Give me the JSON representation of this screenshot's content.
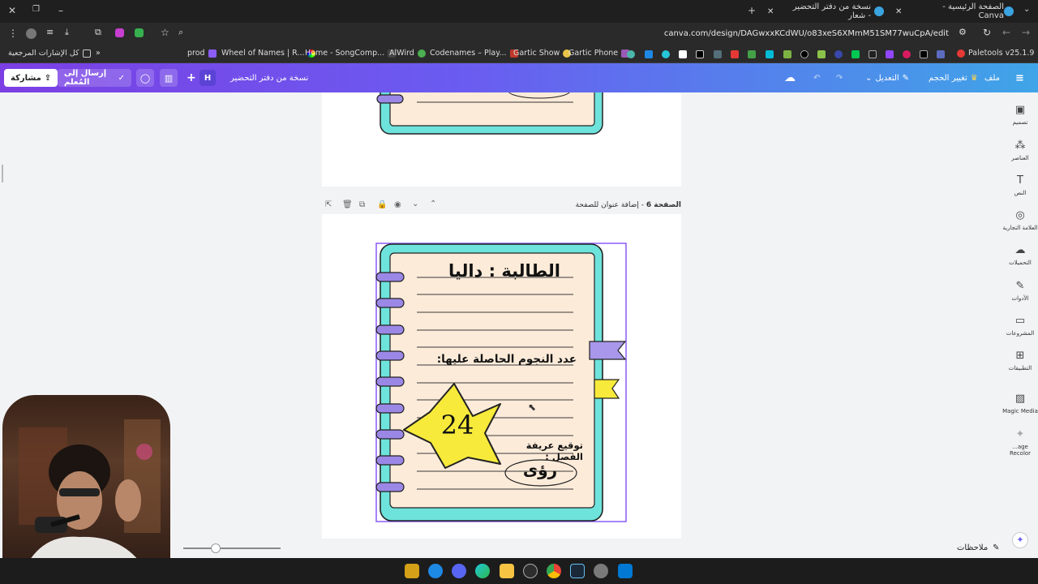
{
  "browser": {
    "tabs": [
      {
        "label": "الصفحة الرئيسية - Canva"
      },
      {
        "label": "نسخة من دفتر التحضير - شعار"
      }
    ],
    "url": "canva.com/design/DAGwxxKCdWU/o83xeS6XMmM51SM77wuCpA/edit",
    "bookmarks": [
      {
        "label": "كل الإشارات المرجعية"
      },
      {
        "label": "prod"
      },
      {
        "label": "Wheel of Names | R..."
      },
      {
        "label": "Home - SongComp..."
      },
      {
        "label": "AlWird"
      },
      {
        "label": "Codenames – Play..."
      },
      {
        "label": "Gartic Show"
      },
      {
        "label": "Gartic Phone"
      },
      {
        "label": "Paletools v25.1.9"
      }
    ]
  },
  "canva": {
    "share_label": "مشاركة",
    "send_teacher_label": "إرسال إلى المُعلم",
    "avatar_letter": "H",
    "doc_title": "نسخة من دفتر التحضير",
    "edit_label": "التعديل",
    "resize_label": "تغيير الحجم",
    "file_label": "ملف"
  },
  "side_panel": [
    {
      "label": "تصميم",
      "icon": "layout-icon"
    },
    {
      "label": "العناصر",
      "icon": "shapes-icon"
    },
    {
      "label": "النص",
      "icon": "text-icon"
    },
    {
      "label": "العلامة التجارية",
      "icon": "brand-icon"
    },
    {
      "label": "التحميلات",
      "icon": "cloud-upload-icon"
    },
    {
      "label": "الأدوات",
      "icon": "pen-icon"
    },
    {
      "label": "المشروعات",
      "icon": "folder-icon"
    },
    {
      "label": "التطبيقات",
      "icon": "apps-icon"
    },
    {
      "label": "Magic Media",
      "icon": "magic-media-icon"
    },
    {
      "label": "...age Recolor",
      "icon": "recolor-icon"
    }
  ],
  "page_header": {
    "title": "الصفحة 6",
    "add_title": "إضافة عنوان للصفحة"
  },
  "page": {
    "student_label": "الطالبة : داليا",
    "stars_label": "عدد النجوم الحاصلة عليها:",
    "star_count": "24",
    "signature_label": "توقيع عريفة الفصل :",
    "signature": "رؤى"
  },
  "footer": {
    "notes_label": "ملاحظات"
  },
  "colors": {
    "notebook_frame": "#6ee3dc",
    "paper": "#fdebd9",
    "ring": "#9b88e6",
    "star": "#f7ea3a",
    "tab_purple": "#a897ea",
    "tab_yellow": "#f7ea3a"
  }
}
